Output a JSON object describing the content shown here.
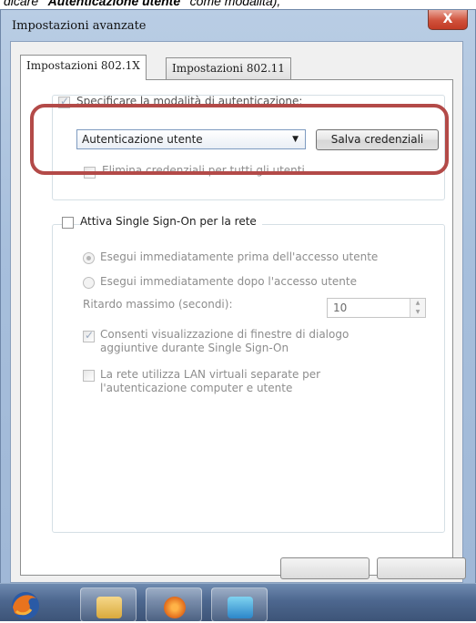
{
  "caption": {
    "prefix": "dicare ",
    "bold": "\"Autenticazione utente\"",
    "suffix": " come modalità),"
  },
  "window": {
    "title": "Impostazioni avanzate",
    "close_label": "X"
  },
  "tabs": [
    {
      "label": "Impostazioni 802.1X",
      "active": true
    },
    {
      "label": "Impostazioni 802.11",
      "active": false
    }
  ],
  "auth_group": {
    "specify_label": "Specificare la modalità di autenticazione:",
    "mode_value": "Autenticazione utente",
    "save_credentials_label": "Salva credenziali",
    "delete_credentials_label": "Elimina credenziali per tutti gli utenti"
  },
  "sso_group": {
    "enable_label": "Attiva Single Sign-On per la rete",
    "radio_before": "Esegui immediatamente prima dell'accesso utente",
    "radio_after": "Esegui immediatamente dopo l'accesso utente",
    "max_delay_label": "Ritardo massimo (secondi):",
    "max_delay_value": "10",
    "allow_dialogs_line1": "Consenti visualizzazione di finestre di dialogo",
    "allow_dialogs_line2": "aggiuntive durante Single Sign-On",
    "vlan_line1": "La rete utilizza LAN virtuali separate per",
    "vlan_line2": "l'autenticazione computer e utente"
  },
  "colors": {
    "highlight": "#b34a48",
    "window_frame": "#a7bfdc"
  },
  "taskbar": {
    "icons": [
      "firefox-icon",
      "folder-icon",
      "media-player-icon",
      "control-panel-icon"
    ]
  }
}
